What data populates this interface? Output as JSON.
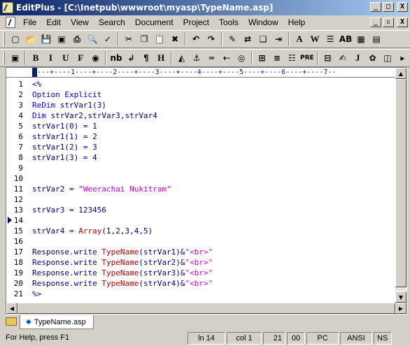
{
  "window": {
    "title": "EditPlus - [C:\\Inetpub\\wwwroot\\myasp\\TypeName.asp]",
    "controls": [
      "_",
      "□",
      "X"
    ],
    "mdi_controls": [
      "_",
      "▫",
      "X"
    ]
  },
  "menu": [
    "File",
    "Edit",
    "View",
    "Search",
    "Document",
    "Project",
    "Tools",
    "Window",
    "Help"
  ],
  "toolbar1": [
    {
      "name": "new-file-icon",
      "glyph": "▢"
    },
    {
      "name": "open-folder-icon",
      "glyph": "📂"
    },
    {
      "name": "save-icon",
      "glyph": "💾"
    },
    {
      "name": "save-all-icon",
      "glyph": "▣"
    },
    {
      "name": "print-icon",
      "glyph": "⎙"
    },
    {
      "name": "print-preview-icon",
      "glyph": "🔍"
    },
    {
      "name": "spell-check-icon",
      "glyph": "✓"
    },
    {
      "name": "cut-icon",
      "glyph": "✂"
    },
    {
      "name": "copy-icon",
      "glyph": "❐"
    },
    {
      "name": "paste-icon",
      "glyph": "📋"
    },
    {
      "name": "delete-icon",
      "glyph": "✖"
    },
    {
      "name": "undo-icon",
      "glyph": "↶"
    },
    {
      "name": "redo-icon",
      "glyph": "↷"
    },
    {
      "name": "find-icon",
      "glyph": "✎"
    },
    {
      "name": "replace-icon",
      "glyph": "⇄"
    },
    {
      "name": "find-in-files-icon",
      "glyph": "❏"
    },
    {
      "name": "goto-icon",
      "glyph": "⇥"
    },
    {
      "name": "font-icon",
      "glyph": "A"
    },
    {
      "name": "word-wrap-icon",
      "glyph": "W"
    },
    {
      "name": "line-number-icon",
      "glyph": "☰"
    },
    {
      "name": "column-icon",
      "glyph": "AB"
    },
    {
      "name": "browser-icon",
      "glyph": "▦"
    },
    {
      "name": "options-icon",
      "glyph": "▤"
    }
  ],
  "toolbar2": [
    {
      "name": "html-preview-icon",
      "glyph": "▣"
    },
    {
      "name": "bold-icon",
      "glyph": "B"
    },
    {
      "name": "italic-icon",
      "glyph": "I"
    },
    {
      "name": "underline-icon",
      "glyph": "U"
    },
    {
      "name": "font-tag-icon",
      "glyph": "F"
    },
    {
      "name": "color-icon",
      "glyph": "◉"
    },
    {
      "name": "nbsp-icon",
      "glyph": "nb"
    },
    {
      "name": "br-icon",
      "glyph": "↲"
    },
    {
      "name": "paragraph-icon",
      "glyph": "¶"
    },
    {
      "name": "heading-icon",
      "glyph": "H"
    },
    {
      "name": "image-icon",
      "glyph": "◭"
    },
    {
      "name": "anchor-icon",
      "glyph": "⚓"
    },
    {
      "name": "hr-icon",
      "glyph": "═"
    },
    {
      "name": "comment-icon",
      "glyph": "⇠"
    },
    {
      "name": "target-icon",
      "glyph": "◎"
    },
    {
      "name": "table-icon",
      "glyph": "⊞"
    },
    {
      "name": "center-icon",
      "glyph": "≡"
    },
    {
      "name": "list-icon",
      "glyph": "☷"
    },
    {
      "name": "pre-icon",
      "glyph": "PRE"
    },
    {
      "name": "form-icon",
      "glyph": "⊟"
    },
    {
      "name": "script-icon",
      "glyph": "✍"
    },
    {
      "name": "javascript-icon",
      "glyph": "J"
    },
    {
      "name": "color-picker-icon",
      "glyph": "✿"
    },
    {
      "name": "tag-icon",
      "glyph": "◫"
    },
    {
      "name": "more-icon",
      "glyph": "▸"
    }
  ],
  "ruler": "---+----1----+----2----+----3----+----4----+----5----+----6----+----7--",
  "editor": {
    "lines": [
      {
        "n": "1",
        "parts": [
          {
            "t": "<%",
            "c": "code"
          }
        ]
      },
      {
        "n": "2",
        "parts": [
          {
            "t": "Option Explicit",
            "c": "kw"
          }
        ]
      },
      {
        "n": "3",
        "parts": [
          {
            "t": "ReDim",
            "c": "kw"
          },
          {
            "t": " strVar1(3)",
            "c": "code"
          }
        ]
      },
      {
        "n": "4",
        "parts": [
          {
            "t": "Dim",
            "c": "kw"
          },
          {
            "t": " strVar2,strVar3,strVar4",
            "c": "code"
          }
        ]
      },
      {
        "n": "5",
        "parts": [
          {
            "t": "strVar1(0) = 1",
            "c": "code"
          }
        ]
      },
      {
        "n": "6",
        "parts": [
          {
            "t": "strVar1(1) = 2",
            "c": "code"
          }
        ]
      },
      {
        "n": "7",
        "parts": [
          {
            "t": "strVar1(2) = 3",
            "c": "code"
          }
        ]
      },
      {
        "n": "8",
        "parts": [
          {
            "t": "strVar1(3) = 4",
            "c": "code"
          }
        ]
      },
      {
        "n": "9",
        "parts": []
      },
      {
        "n": "10",
        "parts": []
      },
      {
        "n": "11",
        "parts": [
          {
            "t": "strVar2 = ",
            "c": "code"
          },
          {
            "t": "\"Weerachai Nukitram\"",
            "c": "str"
          }
        ]
      },
      {
        "n": "12",
        "parts": []
      },
      {
        "n": "13",
        "parts": [
          {
            "t": "strVar3 = 123456",
            "c": "code"
          }
        ]
      },
      {
        "n": "14",
        "parts": [],
        "marker": true
      },
      {
        "n": "15",
        "parts": [
          {
            "t": "strVar4 = ",
            "c": "code"
          },
          {
            "t": "Array",
            "c": "fn"
          },
          {
            "t": "(1,2,3,4,5)",
            "c": "code"
          }
        ]
      },
      {
        "n": "16",
        "parts": []
      },
      {
        "n": "17",
        "parts": [
          {
            "t": "Response.write ",
            "c": "code"
          },
          {
            "t": "TypeName",
            "c": "fn"
          },
          {
            "t": "(strVar1)&",
            "c": "code"
          },
          {
            "t": "\"<br>\"",
            "c": "str"
          }
        ]
      },
      {
        "n": "18",
        "parts": [
          {
            "t": "Response.write ",
            "c": "code"
          },
          {
            "t": "TypeName",
            "c": "fn"
          },
          {
            "t": "(strVar2)&",
            "c": "code"
          },
          {
            "t": "\"<br>\"",
            "c": "str"
          }
        ]
      },
      {
        "n": "19",
        "parts": [
          {
            "t": "Response.write ",
            "c": "code"
          },
          {
            "t": "TypeName",
            "c": "fn"
          },
          {
            "t": "(strVar3)&",
            "c": "code"
          },
          {
            "t": "\"<br>\"",
            "c": "str"
          }
        ]
      },
      {
        "n": "20",
        "parts": [
          {
            "t": "Response.write ",
            "c": "code"
          },
          {
            "t": "TypeName",
            "c": "fn"
          },
          {
            "t": "(strVar4)&",
            "c": "code"
          },
          {
            "t": "\"<br>\"",
            "c": "str"
          }
        ]
      },
      {
        "n": "21",
        "parts": [
          {
            "t": "%>",
            "c": "code"
          }
        ]
      }
    ]
  },
  "tabs": {
    "active": "TypeName.asp"
  },
  "status": {
    "help": "For Help, press F1",
    "line": "ln 14",
    "col": "col 1",
    "chars": "21",
    "hex": "00",
    "format": "PC",
    "encoding": "ANSI",
    "insert": "NS"
  },
  "colors": {
    "titlebar_start": "#0a246a",
    "titlebar_end": "#a6caf0",
    "keyword": "#0000ff",
    "string": "#d400d4",
    "function": "#c00000",
    "code": "#00008b"
  }
}
